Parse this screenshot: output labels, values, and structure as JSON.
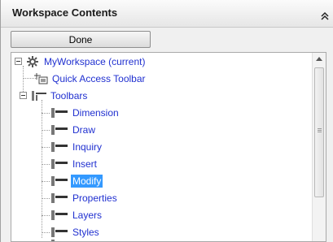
{
  "header": {
    "title": "Workspace Contents"
  },
  "done_button": {
    "label": "Done"
  },
  "tree": {
    "root": {
      "label": "MyWorkspace (current)"
    },
    "quick_access": {
      "label": "Quick Access Toolbar"
    },
    "toolbars": {
      "label": "Toolbars",
      "items": [
        {
          "label": "Dimension"
        },
        {
          "label": "Draw"
        },
        {
          "label": "Inquiry"
        },
        {
          "label": "Insert"
        },
        {
          "label": "Modify",
          "selected": true
        },
        {
          "label": "Properties"
        },
        {
          "label": "Layers"
        },
        {
          "label": "Styles"
        }
      ]
    }
  },
  "icons": {
    "collapse": "double-chevron-up-icon",
    "root": "gear-icon",
    "quick_access": "quick-access-toolbar-icon",
    "toolbars": "toolbars-icon",
    "toolbar": "toolbar-icon"
  },
  "colors": {
    "link": "#2030d0",
    "selection": "#3399ff"
  }
}
